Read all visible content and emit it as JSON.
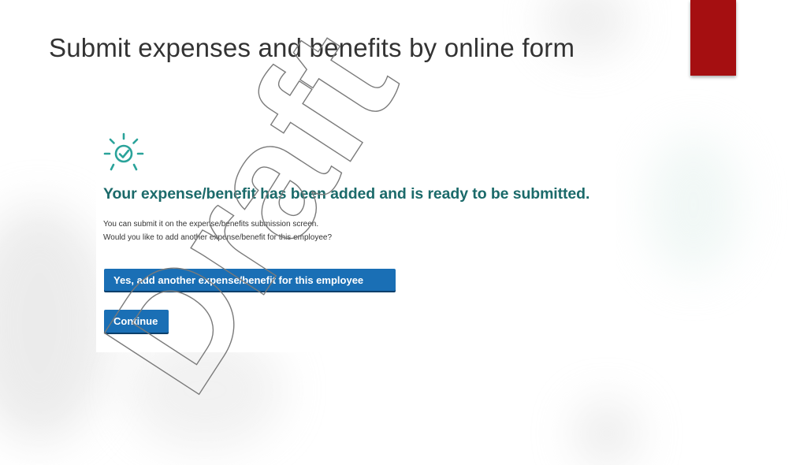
{
  "slide": {
    "title": "Submit expenses and benefits by online form",
    "accent_color": "#a50f11",
    "watermark_text": "Draft"
  },
  "confirmation": {
    "icon": "sun-check-icon",
    "heading": "Your expense/benefit has been added and is ready to be submitted.",
    "info_line_1": "You can submit it on the expense/benefits submission screen.",
    "info_line_2": "Would you like to add another expense/benefit for this employee?",
    "add_another_label": "Yes, add another expense/benefit for this employee",
    "continue_label": "Continue",
    "heading_color": "#1b6a6a",
    "button_color": "#1a6fb5",
    "icon_color": "#2aa39a"
  }
}
